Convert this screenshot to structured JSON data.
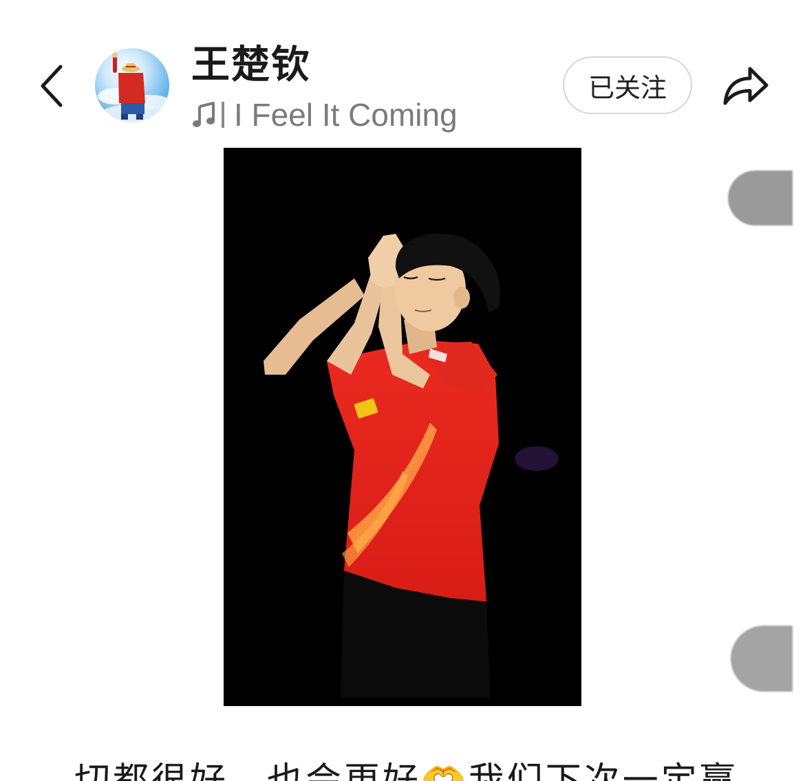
{
  "header": {
    "user_name": "王楚钦",
    "music_title": "I Feel It Coming",
    "follow_label": "已关注"
  },
  "icons": {
    "back": "chevron-left-icon",
    "music": "music-note-icon",
    "share": "share-arrow-icon"
  },
  "post": {
    "caption": "切都很好，也会更好🫶我们下次一定赢"
  },
  "colors": {
    "jersey": "#e3211c",
    "photo_bg": "#000000",
    "sky": "#5fb0ea",
    "follow_border": "#d6d6d6",
    "muted_text": "#7a7a7a"
  }
}
